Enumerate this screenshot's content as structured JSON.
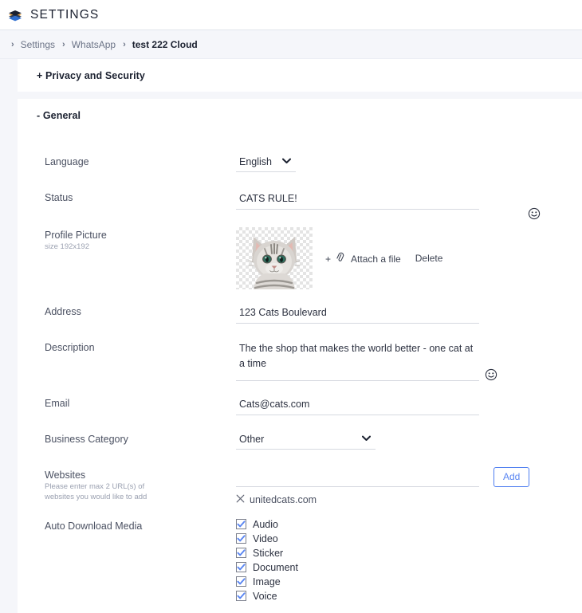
{
  "header": {
    "title": "SETTINGS",
    "logo_icon": "layers-icon"
  },
  "breadcrumb": {
    "separator": "›",
    "items": [
      {
        "label": "Settings",
        "current": false
      },
      {
        "label": "WhatsApp",
        "current": false
      },
      {
        "label": "test 222 Cloud",
        "current": true
      }
    ]
  },
  "sections": [
    {
      "id": "privacy",
      "title": "+ Privacy and Security",
      "expanded": false
    },
    {
      "id": "general",
      "title": "- General",
      "expanded": true
    }
  ],
  "general": {
    "language": {
      "label": "Language",
      "value": "English",
      "options": [
        "English"
      ],
      "chevron_icon": "chevron-down-icon"
    },
    "status": {
      "label": "Status",
      "value": "CATS RULE!",
      "placeholder": "",
      "emoji_icon": "smiley-icon"
    },
    "profile_picture": {
      "label": "Profile Picture",
      "sublabel": "size 192x192",
      "image_alt": "cat-avatar",
      "attach_label": "Attach a file",
      "attach_plus": "+",
      "attach_icon": "paperclip-icon",
      "delete_label": "Delete"
    },
    "address": {
      "label": "Address",
      "value": "123 Cats Boulevard",
      "placeholder": ""
    },
    "description": {
      "label": "Description",
      "value": "The the shop that makes the world better - one cat at a time",
      "placeholder": "",
      "emoji_icon": "smiley-icon"
    },
    "email": {
      "label": "Email",
      "value": "Cats@cats.com",
      "placeholder": ""
    },
    "business_category": {
      "label": "Business Category",
      "value": "Other",
      "options": [
        "Other"
      ],
      "chevron_icon": "chevron-down-icon"
    },
    "websites": {
      "label": "Websites",
      "sublabel": "Please enter max 2 URL(s) of websites you would like to add",
      "input_value": "",
      "placeholder": "",
      "add_label": "Add",
      "entries": [
        {
          "remove_icon": "close-icon",
          "url": "unitedcats.com"
        }
      ]
    },
    "auto_download_media": {
      "label": "Auto Download Media",
      "items": [
        {
          "label": "Audio",
          "checked": true
        },
        {
          "label": "Video",
          "checked": true
        },
        {
          "label": "Sticker",
          "checked": true
        },
        {
          "label": "Document",
          "checked": true
        },
        {
          "label": "Image",
          "checked": true
        },
        {
          "label": "Voice",
          "checked": true
        }
      ]
    }
  },
  "colors": {
    "accent_blue": "#5a86f2",
    "rail_grey": "#f5f6fa",
    "text_dark": "#1b2130",
    "text_muted": "#6b7386",
    "underline": "#d6d9e0"
  }
}
